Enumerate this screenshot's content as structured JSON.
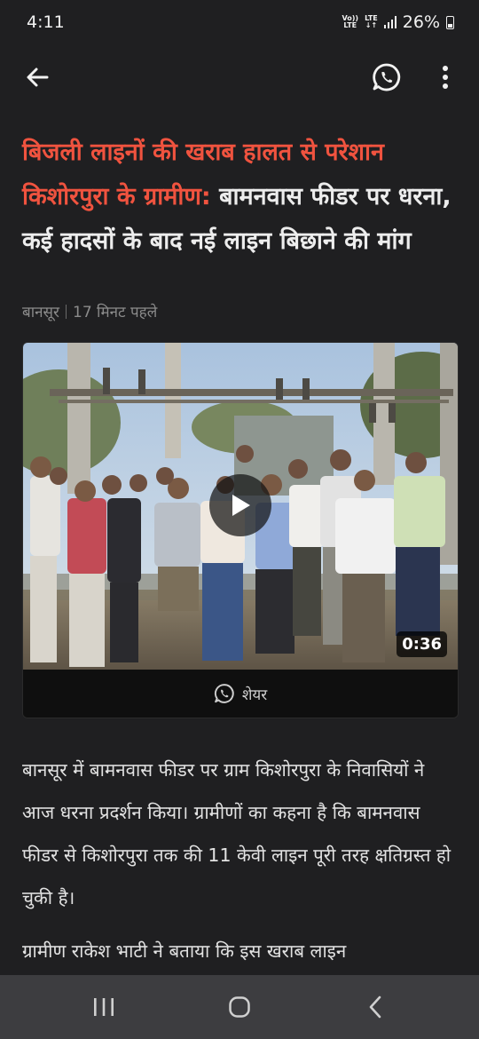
{
  "status_bar": {
    "time": "4:11",
    "volte_top": "Vo))",
    "volte_bottom": "LTE",
    "lte_top": "LTE",
    "lte_bottom": "↓↑",
    "battery": "26%"
  },
  "app_bar": {
    "back_icon": "arrow-left-icon",
    "share_icon": "whatsapp-icon",
    "menu_icon": "more-vertical-icon"
  },
  "article": {
    "headline_highlight": "बिजली लाइनों की खराब हालत से परेशान किशोरपुरा के ग्रामीण:",
    "headline_rest": " बामनवास फीडर पर धरना, कई हादसों के बाद नई लाइन बिछाने की मांग",
    "location": "बानसूर",
    "time_ago": "17 मिनट पहले",
    "video": {
      "duration": "0:36",
      "share_label": "शेयर",
      "play_icon": "play-icon"
    },
    "paragraphs": [
      "बानसूर में बामनवास फीडर पर ग्राम किशोरपुरा के निवासियों ने आज धरना प्रदर्शन किया। ग्रामीणों का कहना है कि बामनवास फीडर से किशोरपुरा तक की 11 केवी लाइन पूरी तरह क्षतिग्रस्त हो चुकी है।",
      "ग्रामीण राकेश भाटी ने बताया कि इस खराब लाइन"
    ]
  },
  "colors": {
    "background": "#1f1f21",
    "headline_accent": "#f0533f",
    "nav_bar": "#3d3d40"
  }
}
